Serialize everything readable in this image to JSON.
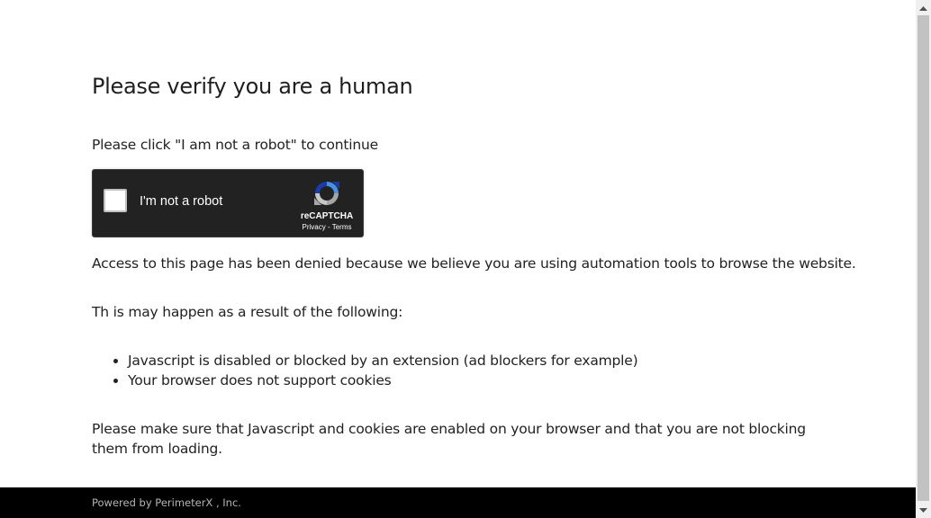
{
  "page": {
    "title": "Please verify you are a human",
    "instruction": "Please click \"I am not a robot\" to continue",
    "denied_message": "Access to this page has been denied because we believe you are using automation tools to browse the website.",
    "reasons_title": "Th is may happen as a result of the following:",
    "reasons": [
      "Javascript is disabled or blocked by an extension (ad blockers for example)",
      "Your browser does not support cookies"
    ],
    "final_message": "Please make sure that Javascript and cookies are enabled on your browser and that you are not blocking them from loading."
  },
  "captcha": {
    "checkbox_label": "I'm not a robot",
    "brand": "reCAPTCHA",
    "privacy_link": "Privacy",
    "separator": " - ",
    "terms_link": "Terms",
    "logo_icon": "recaptcha-logo-icon",
    "background_color": "#222222"
  },
  "footer": {
    "text": "Powered by PerimeterX , Inc."
  },
  "scrollbar": {
    "up_icon": "scroll-up-arrow-icon",
    "down_icon": "scroll-down-arrow-icon"
  }
}
